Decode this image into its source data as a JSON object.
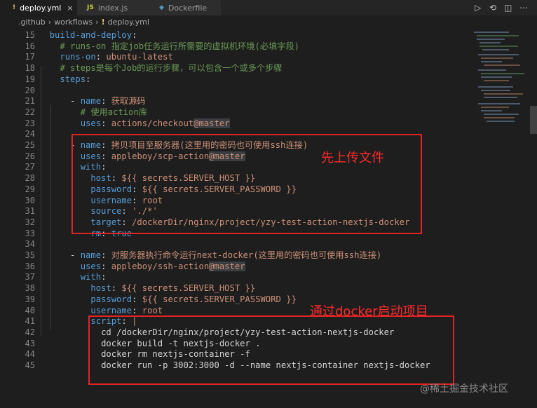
{
  "tabs": [
    {
      "icon": "!",
      "label": "deploy.yml",
      "close": "×"
    },
    {
      "icon": "JS",
      "label": "index.js",
      "close": ""
    },
    {
      "icon": "◆",
      "label": "Dockerfile",
      "close": ""
    }
  ],
  "tab_actions": [
    "▷",
    "⟲",
    "◫",
    "⋯"
  ],
  "breadcrumb": [
    ".github",
    "workflows",
    "deploy.yml"
  ],
  "lines": [
    {
      "n": "15",
      "tokens": [
        {
          "t": "  ",
          "c": "p"
        },
        {
          "t": "build-and-deploy",
          "c": "k"
        },
        {
          "t": ":",
          "c": "p"
        }
      ]
    },
    {
      "n": "16",
      "tokens": [
        {
          "t": "    ",
          "c": "p"
        },
        {
          "t": "# runs-on 指定job任务运行所需要的虚拟机环境(必填字段)",
          "c": "c"
        }
      ]
    },
    {
      "n": "17",
      "tokens": [
        {
          "t": "    ",
          "c": "p"
        },
        {
          "t": "runs-on",
          "c": "k"
        },
        {
          "t": ": ",
          "c": "p"
        },
        {
          "t": "ubuntu-latest",
          "c": "v"
        }
      ]
    },
    {
      "n": "18",
      "tokens": [
        {
          "t": "    ",
          "c": "p"
        },
        {
          "t": "# steps是每个Job的运行步骤，可以包含一个或多个步骤",
          "c": "c"
        }
      ]
    },
    {
      "n": "19",
      "tokens": [
        {
          "t": "    ",
          "c": "p"
        },
        {
          "t": "steps",
          "c": "k"
        },
        {
          "t": ":",
          "c": "p"
        }
      ]
    },
    {
      "n": "20",
      "tokens": []
    },
    {
      "n": "21",
      "tokens": [
        {
          "t": "      - ",
          "c": "p"
        },
        {
          "t": "name",
          "c": "k"
        },
        {
          "t": ": ",
          "c": "p"
        },
        {
          "t": "获取源码",
          "c": "v"
        }
      ]
    },
    {
      "n": "22",
      "tokens": [
        {
          "t": "        ",
          "c": "p"
        },
        {
          "t": "# 使用action库",
          "c": "c"
        }
      ]
    },
    {
      "n": "23",
      "tokens": [
        {
          "t": "        ",
          "c": "p"
        },
        {
          "t": "uses",
          "c": "k"
        },
        {
          "t": ": ",
          "c": "p"
        },
        {
          "t": "actions/checkout",
          "c": "v"
        },
        {
          "t": "@master",
          "c": "v",
          "hl": true
        }
      ]
    },
    {
      "n": "24",
      "tokens": []
    },
    {
      "n": "25",
      "tokens": [
        {
          "t": "      - ",
          "c": "p"
        },
        {
          "t": "name",
          "c": "k"
        },
        {
          "t": ": ",
          "c": "p"
        },
        {
          "t": "拷贝项目至服务器(这里用的密码也可使用ssh连接)",
          "c": "v"
        }
      ]
    },
    {
      "n": "26",
      "tokens": [
        {
          "t": "        ",
          "c": "p"
        },
        {
          "t": "uses",
          "c": "k"
        },
        {
          "t": ": ",
          "c": "p"
        },
        {
          "t": "appleboy/scp-action",
          "c": "v"
        },
        {
          "t": "@master",
          "c": "v",
          "hl": true
        }
      ]
    },
    {
      "n": "27",
      "tokens": [
        {
          "t": "        ",
          "c": "p"
        },
        {
          "t": "with",
          "c": "k"
        },
        {
          "t": ":",
          "c": "p"
        }
      ]
    },
    {
      "n": "28",
      "tokens": [
        {
          "t": "          ",
          "c": "p"
        },
        {
          "t": "host",
          "c": "k"
        },
        {
          "t": ": ",
          "c": "p"
        },
        {
          "t": "${{ ",
          "c": "v"
        },
        {
          "t": "secrets.SERVER_HOST",
          "c": "v"
        },
        {
          "t": " }}",
          "c": "v"
        }
      ]
    },
    {
      "n": "29",
      "tokens": [
        {
          "t": "          ",
          "c": "p"
        },
        {
          "t": "password",
          "c": "k"
        },
        {
          "t": ": ",
          "c": "p"
        },
        {
          "t": "${{ ",
          "c": "v"
        },
        {
          "t": "secrets.SERVER_PASSWORD",
          "c": "v"
        },
        {
          "t": " }}",
          "c": "v"
        }
      ]
    },
    {
      "n": "30",
      "tokens": [
        {
          "t": "          ",
          "c": "p"
        },
        {
          "t": "username",
          "c": "k"
        },
        {
          "t": ": ",
          "c": "p"
        },
        {
          "t": "root",
          "c": "v"
        }
      ]
    },
    {
      "n": "31",
      "tokens": [
        {
          "t": "          ",
          "c": "p"
        },
        {
          "t": "source",
          "c": "k"
        },
        {
          "t": ": ",
          "c": "p"
        },
        {
          "t": "'./*'",
          "c": "v"
        }
      ]
    },
    {
      "n": "32",
      "tokens": [
        {
          "t": "          ",
          "c": "p"
        },
        {
          "t": "target",
          "c": "k"
        },
        {
          "t": ": ",
          "c": "p"
        },
        {
          "t": "/dockerDir/nginx/project/yzy-test-action-nextjs-docker",
          "c": "v"
        }
      ]
    },
    {
      "n": "33",
      "tokens": [
        {
          "t": "          ",
          "c": "p"
        },
        {
          "t": "rm",
          "c": "k"
        },
        {
          "t": ": ",
          "c": "p"
        },
        {
          "t": "true",
          "c": "k"
        }
      ]
    },
    {
      "n": "34",
      "tokens": []
    },
    {
      "n": "35",
      "tokens": [
        {
          "t": "      - ",
          "c": "p"
        },
        {
          "t": "name",
          "c": "k"
        },
        {
          "t": ": ",
          "c": "p"
        },
        {
          "t": "对服务器执行命令运行next-docker(这里用的密码也可使用ssh连接)",
          "c": "v"
        }
      ]
    },
    {
      "n": "36",
      "tokens": [
        {
          "t": "        ",
          "c": "p"
        },
        {
          "t": "uses",
          "c": "k"
        },
        {
          "t": ": ",
          "c": "p"
        },
        {
          "t": "appleboy/ssh-action",
          "c": "v"
        },
        {
          "t": "@master",
          "c": "v",
          "hl": true
        }
      ]
    },
    {
      "n": "37",
      "tokens": [
        {
          "t": "        ",
          "c": "p"
        },
        {
          "t": "with",
          "c": "k"
        },
        {
          "t": ":",
          "c": "p"
        }
      ]
    },
    {
      "n": "38",
      "tokens": [
        {
          "t": "          ",
          "c": "p"
        },
        {
          "t": "host",
          "c": "k"
        },
        {
          "t": ": ",
          "c": "p"
        },
        {
          "t": "${{ ",
          "c": "v"
        },
        {
          "t": "secrets.SERVER_HOST",
          "c": "v"
        },
        {
          "t": " }}",
          "c": "v"
        }
      ]
    },
    {
      "n": "39",
      "tokens": [
        {
          "t": "          ",
          "c": "p"
        },
        {
          "t": "password",
          "c": "k"
        },
        {
          "t": ": ",
          "c": "p"
        },
        {
          "t": "${{ ",
          "c": "v"
        },
        {
          "t": "secrets.SERVER_PASSWORD",
          "c": "v"
        },
        {
          "t": " }}",
          "c": "v"
        }
      ]
    },
    {
      "n": "40",
      "tokens": [
        {
          "t": "          ",
          "c": "p"
        },
        {
          "t": "username",
          "c": "k"
        },
        {
          "t": ": ",
          "c": "p"
        },
        {
          "t": "root",
          "c": "v"
        }
      ]
    },
    {
      "n": "41",
      "tokens": [
        {
          "t": "          ",
          "c": "p"
        },
        {
          "t": "script",
          "c": "k"
        },
        {
          "t": ": ",
          "c": "p"
        },
        {
          "t": "|",
          "c": "v"
        }
      ]
    },
    {
      "n": "42",
      "tokens": [
        {
          "t": "            ",
          "c": "p"
        },
        {
          "t": "cd /dockerDir/nginx/project/yzy-test-action-nextjs-docker",
          "c": "p"
        }
      ]
    },
    {
      "n": "43",
      "tokens": [
        {
          "t": "            ",
          "c": "p"
        },
        {
          "t": "docker build -t nextjs-docker .",
          "c": "p"
        }
      ]
    },
    {
      "n": "44",
      "tokens": [
        {
          "t": "            ",
          "c": "p"
        },
        {
          "t": "docker rm nextjs-container -f",
          "c": "p"
        }
      ]
    },
    {
      "n": "45",
      "tokens": [
        {
          "t": "            ",
          "c": "p"
        },
        {
          "t": "docker run -p 3002:3000 -d --name nextjs-container nextjs-docker",
          "c": "p"
        }
      ]
    }
  ],
  "annotations": {
    "upload_note": "先上传文件",
    "docker_note": "通过docker启动项目"
  },
  "watermark": "@稀土掘金技术社区",
  "colors": {
    "keyword": "#569cd6",
    "string": "#ce9178",
    "comment": "#6a9955",
    "highlight_box": "#e02424"
  }
}
